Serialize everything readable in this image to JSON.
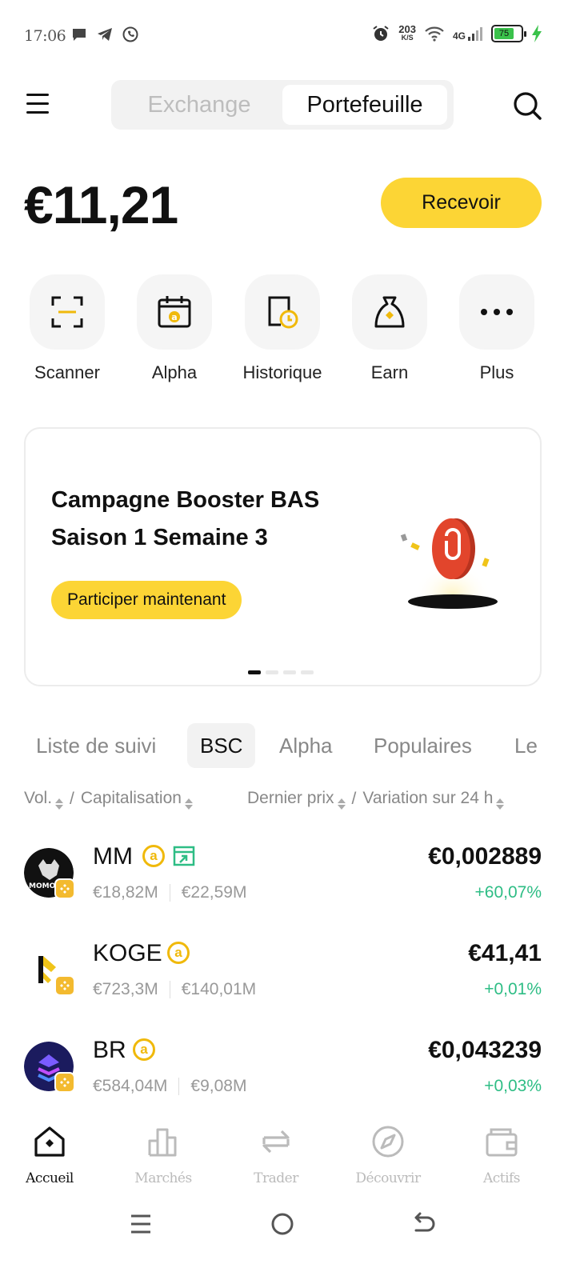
{
  "status_bar": {
    "time": "17:06",
    "net_speed": "203",
    "net_unit": "K/S",
    "network": "4G",
    "battery": "75",
    "battery_level": 0.75
  },
  "header": {
    "tabs": [
      {
        "label": "Exchange",
        "active": false
      },
      {
        "label": "Portefeuille",
        "active": true
      }
    ]
  },
  "balance": {
    "amount": "€11,21",
    "receive_label": "Recevoir"
  },
  "quick_actions": [
    {
      "label": "Scanner",
      "icon": "scan-icon"
    },
    {
      "label": "Alpha",
      "icon": "alpha-calendar-icon"
    },
    {
      "label": "Historique",
      "icon": "history-icon"
    },
    {
      "label": "Earn",
      "icon": "money-bag-icon"
    },
    {
      "label": "Plus",
      "icon": "more-dots-icon"
    }
  ],
  "banner": {
    "title": "Campagne Booster BAS Saison 1 Semaine 3",
    "cta": "Participer maintenant",
    "slides": 4,
    "active_slide": 1
  },
  "filter_tabs": [
    {
      "label": "Liste de suivi",
      "active": false
    },
    {
      "label": "BSC",
      "active": true
    },
    {
      "label": "Alpha",
      "active": false
    },
    {
      "label": "Populaires",
      "active": false
    },
    {
      "label": "Le",
      "active": false
    }
  ],
  "columns": {
    "left_a": "Vol.",
    "left_sep": "/",
    "left_b": "Capitalisation",
    "right_a": "Dernier prix",
    "right_sep": "/",
    "right_b": "Variation sur 24 h"
  },
  "tokens": [
    {
      "name": "MM",
      "volume": "€18,82M",
      "market_cap": "€22,59M",
      "price": "€0,002889",
      "change": "+60,07%"
    },
    {
      "name": "KOGE",
      "volume": "€723,3M",
      "market_cap": "€140,01M",
      "price": "€41,41",
      "change": "+0,01%"
    },
    {
      "name": "BR",
      "volume": "€584,04M",
      "market_cap": "€9,08M",
      "price": "€0,043239",
      "change": "+0,03%"
    }
  ],
  "bottom_nav": [
    {
      "label": "Accueil",
      "active": true
    },
    {
      "label": "Marchés",
      "active": false
    },
    {
      "label": "Trader",
      "active": false
    },
    {
      "label": "Découvrir",
      "active": false
    },
    {
      "label": "Actifs",
      "active": false
    }
  ],
  "colors": {
    "accent": "#fcd535",
    "positive": "#2ebd85",
    "muted": "#888888"
  }
}
